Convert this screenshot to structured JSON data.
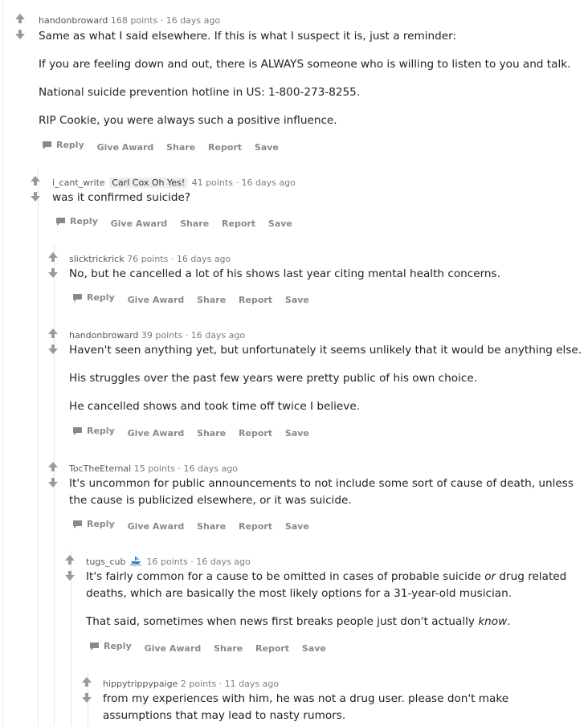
{
  "actions": {
    "reply": "Reply",
    "give_award": "Give Award",
    "share": "Share",
    "report": "Report",
    "save": "Save"
  },
  "comments": [
    {
      "author": "handonbroward",
      "score": "168 points",
      "age": "16 days ago",
      "paragraphs": [
        "Same as what I said elsewhere. If this is what I suspect it is, just a reminder:",
        "If you are feeling down and out, there is ALWAYS someone who is willing to listen to you and talk.",
        "National suicide prevention hotline in US: 1-800-273-8255.",
        "RIP Cookie, you were always such a positive influence."
      ]
    },
    {
      "author": "i_cant_write",
      "flair": "Carl Cox Oh Yes!",
      "score": "41 points",
      "age": "16 days ago",
      "paragraphs": [
        "was it confirmed suicide?"
      ]
    },
    {
      "author": "slicktrickrick",
      "score": "76 points",
      "age": "16 days ago",
      "paragraphs": [
        "No, but he cancelled a lot of his shows last year citing mental health concerns."
      ]
    },
    {
      "author": "handonbroward",
      "score": "39 points",
      "age": "16 days ago",
      "paragraphs": [
        "Haven't seen anything yet, but unfortunately it seems unlikely that it would be anything else.",
        "His struggles over the past few years were pretty public of his own choice.",
        "He cancelled shows and took time off twice I believe."
      ]
    },
    {
      "author": "TocTheEternal",
      "score": "15 points",
      "age": "16 days ago",
      "paragraphs": [
        "It's uncommon for public announcements to not include some sort of cause of death, unless",
        "the cause is publicized elsewhere, or it was suicide."
      ]
    },
    {
      "author": "tugs_cub",
      "score": "16 points",
      "age": "16 days ago",
      "flair_icon": "boat-icon",
      "p1_before": "It's fairly common for a cause to be omitted in cases of probable suicide ",
      "p1_em": "or",
      "p1_after": " drug related",
      "p1_line2": "deaths, which are basically the most likely options for a 31-year-old musician.",
      "p2_before": "That said, sometimes when news first breaks people just don't actually ",
      "p2_em": "know",
      "p2_after": "."
    },
    {
      "author": "hippytrippypaige",
      "score": "2 points",
      "age": "11 days ago",
      "paragraphs": [
        "from my experiences with him, he was not a drug user. please don't make",
        "assumptions that may lead to nasty rumors."
      ]
    }
  ]
}
